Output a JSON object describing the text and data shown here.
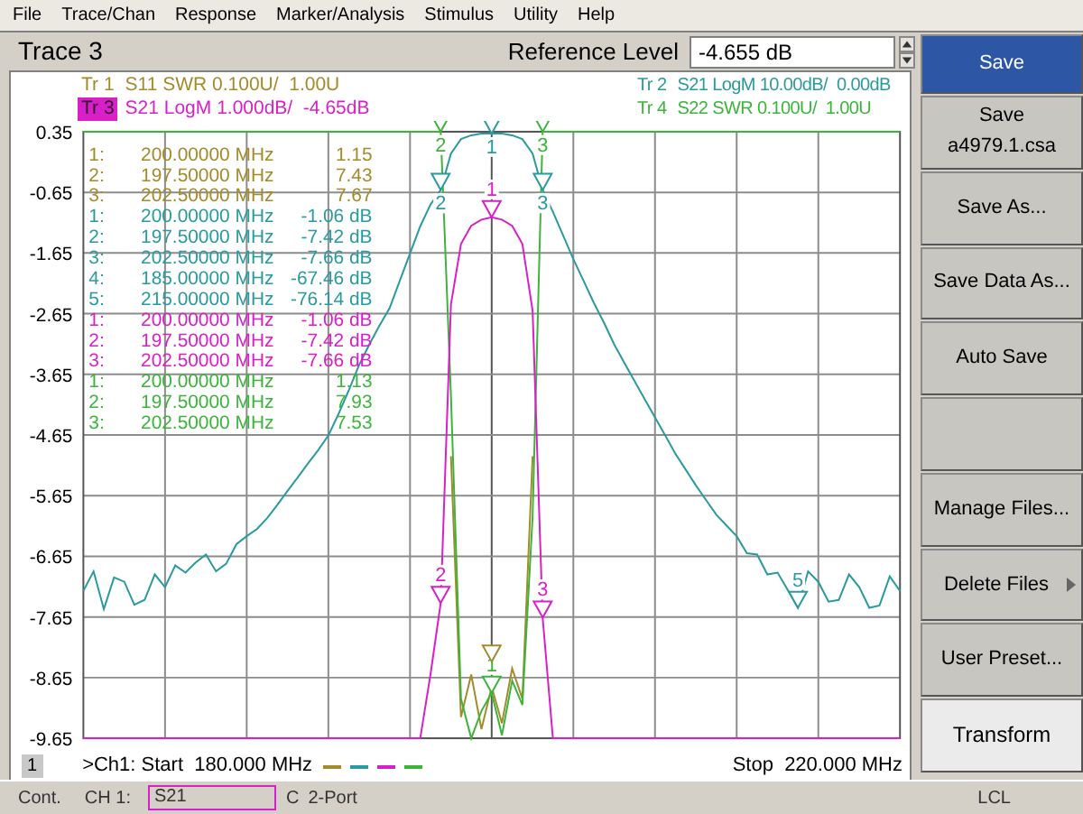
{
  "menu": [
    "File",
    "Trace/Chan",
    "Response",
    "Marker/Analysis",
    "Stimulus",
    "Utility",
    "Help"
  ],
  "title": "Trace 3",
  "reference_level": {
    "label": "Reference Level",
    "value": "-4.655 dB"
  },
  "traces": [
    {
      "description": "S11 SWR 0.100U/  1.00U",
      "selected": false
    },
    {
      "description": "S21 LogM 10.00dB/  0.00dB",
      "selected": false
    },
    {
      "description": "S21 LogM 1.000dB/  -4.65dB",
      "selected": true
    },
    {
      "description": "S22 SWR 0.100U/  1.00U",
      "selected": false
    }
  ],
  "marker_readouts": [
    {
      "color": "#a38b2c",
      "rows": [
        {
          "marker": "1:",
          "frequency": "200.00000 MHz",
          "value": "1.15",
          "on_screen": true
        },
        {
          "marker": "2:",
          "frequency": "197.50000 MHz",
          "value": "7.43",
          "on_screen": false
        },
        {
          "marker": "3:",
          "frequency": "202.50000 MHz",
          "value": "7.67",
          "on_screen": false
        }
      ]
    },
    {
      "color": "#2a9a9e",
      "rows": [
        {
          "marker": "1:",
          "frequency": "200.00000 MHz",
          "value": "-1.06 dB",
          "on_screen": true,
          "symbol": "1"
        },
        {
          "marker": "2:",
          "frequency": "197.50000 MHz",
          "value": "-7.42 dB",
          "on_screen": true,
          "symbol": "2"
        },
        {
          "marker": "3:",
          "frequency": "202.50000 MHz",
          "value": "-7.66 dB",
          "on_screen": true,
          "symbol": "3"
        },
        {
          "marker": "4:",
          "frequency": "185.00000 MHz",
          "value": "-67.46 dB",
          "on_screen": false
        },
        {
          "marker": "5:",
          "frequency": "215.00000 MHz",
          "value": "-76.14 dB",
          "on_screen": true,
          "symbol": "5"
        }
      ]
    },
    {
      "color": "#d81fc8",
      "rows": [
        {
          "marker": "1:",
          "frequency": "200.00000 MHz",
          "value": "-1.06 dB",
          "on_screen": true,
          "symbol": "1"
        },
        {
          "marker": "2:",
          "frequency": "197.50000 MHz",
          "value": "-7.42 dB",
          "on_screen": true,
          "symbol": "2"
        },
        {
          "marker": "3:",
          "frequency": "202.50000 MHz",
          "value": "-7.66 dB",
          "on_screen": true,
          "symbol": "3"
        }
      ]
    },
    {
      "color": "#3cb43c",
      "rows": [
        {
          "marker": "1:",
          "frequency": "200.00000 MHz",
          "value": "1.13",
          "on_screen": true,
          "symbol": "1"
        },
        {
          "marker": "2:",
          "frequency": "197.50000 MHz",
          "value": "7.93",
          "on_screen": true,
          "symbol": "2"
        },
        {
          "marker": "3:",
          "frequency": "202.50000 MHz",
          "value": "7.53",
          "on_screen": true,
          "symbol": "3"
        }
      ]
    }
  ],
  "chart_data": {
    "type": "line",
    "grid": true,
    "ylim": [
      -9.65,
      0.35
    ],
    "yticks": [
      {
        "value": 0.35,
        "label": "0.35"
      },
      {
        "value": -0.65,
        "label": "-0.65"
      },
      {
        "value": -1.65,
        "label": "-1.65"
      },
      {
        "value": -2.65,
        "label": "-2.65"
      },
      {
        "value": -3.65,
        "label": "-3.65"
      },
      {
        "value": -4.65,
        "label": "-4.65"
      },
      {
        "value": -5.65,
        "label": "-5.65"
      },
      {
        "value": -6.65,
        "label": "-6.65"
      },
      {
        "value": -7.65,
        "label": "-7.65"
      },
      {
        "value": -8.65,
        "label": "-8.65"
      },
      {
        "value": -9.65,
        "label": "-9.65"
      }
    ],
    "categories": [
      null,
      null,
      null,
      null,
      null,
      null,
      null,
      null,
      null,
      null,
      null,
      null,
      null,
      null,
      null,
      null,
      null,
      null,
      null,
      null,
      null,
      null,
      null,
      null,
      null,
      null,
      null,
      null,
      null,
      null,
      null,
      null,
      null,
      null,
      null,
      null,
      null,
      null,
      null,
      null,
      null,
      null,
      null,
      null,
      null,
      null,
      null,
      null,
      null,
      null,
      null,
      null,
      null,
      null,
      null,
      null,
      null,
      null,
      null,
      null,
      null,
      null,
      null,
      null,
      null,
      null,
      null,
      null,
      null,
      null,
      null,
      null,
      null,
      null,
      null,
      null,
      null,
      null,
      null,
      null,
      null
    ],
    "series": [
      {
        "name": "Tr 1",
        "color": "#a38b2c",
        "values": [
          null,
          null,
          null,
          null,
          null,
          null,
          null,
          null,
          null,
          null,
          null,
          null,
          null,
          null,
          null,
          null,
          null,
          null,
          null,
          null,
          null,
          null,
          null,
          null,
          null,
          null,
          null,
          null,
          null,
          null,
          null,
          null,
          null,
          null,
          null,
          null,
          -5.0,
          -9.3,
          -8.6,
          -9.5,
          -8.8,
          -9.4,
          -8.5,
          -9.0,
          -5.0,
          null,
          null,
          null,
          null,
          null,
          null,
          null,
          null,
          null,
          null,
          null,
          null,
          null,
          null,
          null,
          null,
          null,
          null,
          null,
          null,
          null,
          null,
          null,
          null,
          null,
          null,
          null,
          null,
          null,
          null,
          null,
          null,
          null,
          null,
          null,
          null
        ]
      },
      {
        "name": "Tr 2",
        "color": "#2a9a9e",
        "values": [
          -7.22,
          -6.9,
          -7.52,
          -7.0,
          -7.07,
          -7.45,
          -7.37,
          -6.95,
          -7.16,
          -6.8,
          -6.92,
          -6.75,
          -6.62,
          -6.9,
          -6.77,
          -6.45,
          -6.32,
          -6.2,
          -6.02,
          -5.8,
          -5.57,
          -5.35,
          -5.12,
          -4.9,
          -4.66,
          -4.3,
          -3.91,
          -3.5,
          -3.16,
          -2.85,
          -2.56,
          -2.11,
          -1.66,
          -1.21,
          -0.85,
          -0.61,
          -0.01,
          0.23,
          0.29,
          0.32,
          0.32,
          0.32,
          0.29,
          0.23,
          -0.01,
          -0.61,
          -0.97,
          -1.36,
          -1.75,
          -2.11,
          -2.47,
          -2.8,
          -3.16,
          -3.46,
          -3.76,
          -4.06,
          -4.36,
          -4.66,
          -4.96,
          -5.22,
          -5.48,
          -5.72,
          -5.96,
          -6.14,
          -6.32,
          -6.6,
          -6.62,
          -6.95,
          -6.92,
          -7.2,
          -7.5,
          -6.9,
          -7.07,
          -7.4,
          -7.37,
          -6.95,
          -7.16,
          -7.5,
          -7.46,
          -6.98,
          -7.22
        ]
      },
      {
        "name": "Tr 3",
        "color": "#d81fc8",
        "values": [
          -9.65,
          -9.65,
          -9.65,
          -9.65,
          -9.65,
          -9.65,
          -9.65,
          -9.65,
          -9.65,
          -9.65,
          -9.65,
          -9.65,
          -9.65,
          -9.65,
          -9.65,
          -9.65,
          -9.65,
          -9.65,
          -9.65,
          -9.65,
          -9.65,
          -9.65,
          -9.65,
          -9.65,
          -9.65,
          -9.65,
          -9.65,
          -9.65,
          -9.65,
          -9.65,
          -9.65,
          -9.65,
          -9.65,
          -9.65,
          -8.6,
          -7.42,
          -2.5,
          -1.5,
          -1.2,
          -1.1,
          -1.06,
          -1.1,
          -1.2,
          -1.5,
          -2.6,
          -7.66,
          -9.65,
          -9.65,
          -9.65,
          -9.65,
          -9.65,
          -9.65,
          -9.65,
          -9.65,
          -9.65,
          -9.65,
          -9.65,
          -9.65,
          -9.65,
          -9.65,
          -9.65,
          -9.65,
          -9.65,
          -9.65,
          -9.65,
          -9.65,
          -9.65,
          -9.65,
          -9.65,
          -9.65,
          -9.65,
          -9.65,
          -9.65,
          -9.65,
          -9.65,
          -9.65,
          -9.65,
          -9.65,
          -9.65,
          -9.65,
          -9.65
        ]
      },
      {
        "name": "Tr 4",
        "color": "#3cb43c",
        "values": [
          0.35,
          0.35,
          0.35,
          0.35,
          0.35,
          0.35,
          0.35,
          0.35,
          0.35,
          0.35,
          0.35,
          0.35,
          0.35,
          0.35,
          0.35,
          0.35,
          0.35,
          0.35,
          0.35,
          0.35,
          0.35,
          0.35,
          0.35,
          0.35,
          0.35,
          0.35,
          0.35,
          0.35,
          0.35,
          0.35,
          0.35,
          0.35,
          0.35,
          0.35,
          0.35,
          0.35,
          -4.0,
          -9.0,
          -9.65,
          -9.2,
          -8.9,
          -9.6,
          -8.7,
          -9.1,
          -6.0,
          0.35,
          0.35,
          0.35,
          0.35,
          0.35,
          0.35,
          0.35,
          0.35,
          0.35,
          0.35,
          0.35,
          0.35,
          0.35,
          0.35,
          0.35,
          0.35,
          0.35,
          0.35,
          0.35,
          0.35,
          0.35,
          0.35,
          0.35,
          0.35,
          0.35,
          0.35,
          0.35,
          0.35,
          0.35,
          0.35,
          0.35,
          0.35,
          0.35,
          0.35,
          0.35,
          0.35
        ]
      }
    ]
  },
  "footer": {
    "channel": "1",
    "start": ">Ch1: Start  180.000 MHz",
    "stop": "Stop  220.000 MHz"
  },
  "softkeys": [
    {
      "kind": "header",
      "lines": [
        "Save"
      ]
    },
    {
      "kind": "key",
      "lines": [
        "Save",
        "a4979.1.csa"
      ]
    },
    {
      "kind": "key",
      "lines": [
        "Save As..."
      ]
    },
    {
      "kind": "key",
      "lines": [
        "Save Data As..."
      ]
    },
    {
      "kind": "key",
      "lines": [
        "Auto Save"
      ]
    },
    {
      "kind": "empty"
    },
    {
      "kind": "key",
      "lines": [
        "Manage Files..."
      ]
    },
    {
      "kind": "submenu",
      "lines": [
        "Delete Files"
      ]
    },
    {
      "kind": "key",
      "lines": [
        "User Preset..."
      ]
    },
    {
      "kind": "light",
      "lines": [
        "Transform"
      ]
    }
  ],
  "status_bar": {
    "mode": "Cont.",
    "channel_label": "CH 1:",
    "measurement": "S21",
    "calibration_flag": "C",
    "port_mode": "2-Port",
    "remote": "LCL"
  }
}
